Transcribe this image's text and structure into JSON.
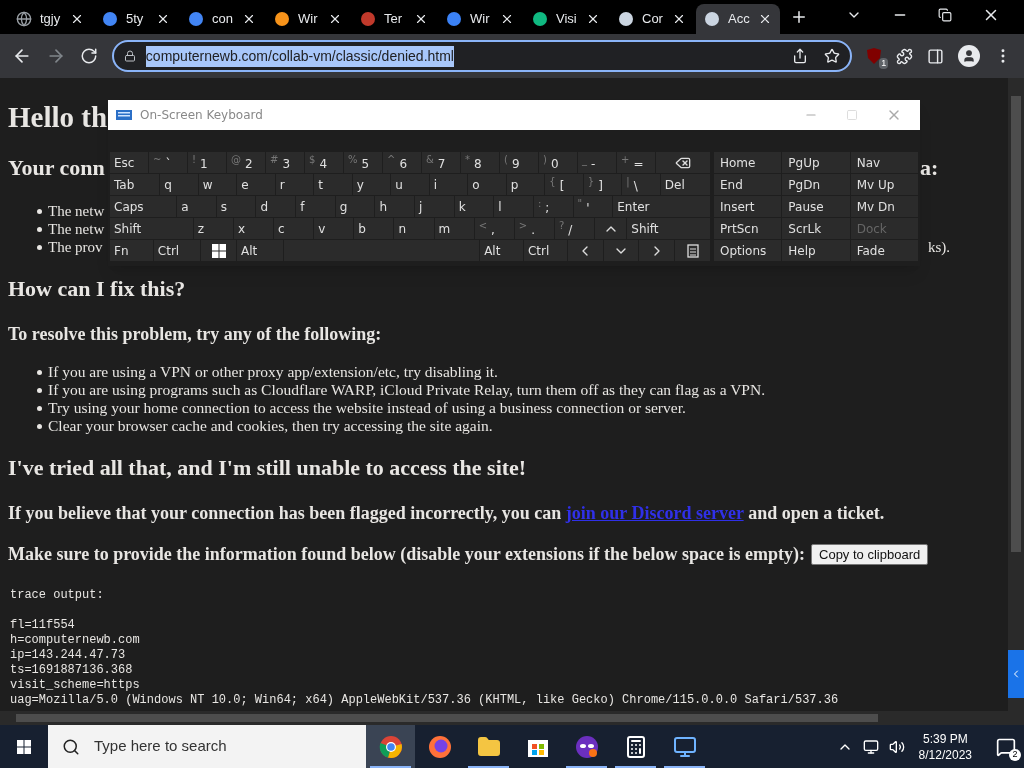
{
  "browser": {
    "tabs": [
      {
        "title": "tgjy",
        "selected": false
      },
      {
        "title": "5ty",
        "selected": false
      },
      {
        "title": "con",
        "selected": false
      },
      {
        "title": "Wir",
        "selected": false
      },
      {
        "title": "Ter",
        "selected": false
      },
      {
        "title": "Wir",
        "selected": false
      },
      {
        "title": "Visi",
        "selected": false
      },
      {
        "title": "Cor",
        "selected": false
      },
      {
        "title": "Acc",
        "selected": true
      }
    ],
    "url": "computernewb.com/collab-vm/classic/denied.html",
    "url_selected": true,
    "extension_badge": "1"
  },
  "page": {
    "heading": "Hello th",
    "section_heading": {
      "left": "Your conn",
      "right": "a:"
    },
    "notice_items": [
      {
        "left": "The netw"
      },
      {
        "left": "The netw"
      },
      {
        "left": "The prov",
        "right": "ks)."
      }
    ],
    "fix_heading": "How can I fix this?",
    "resolve_text": "To resolve this problem, try any of the following:",
    "resolve_items": [
      "If you are using a VPN or other proxy app/extension/etc, try disabling it.",
      "If you are using programs such as Cloudflare WARP, iCloud Private Relay, turn them off as they can flag as a VPN.",
      "Try using your home connection to access the website instead of using a business connection or server.",
      "Clear your browser cache and cookies, then try accessing the site again."
    ],
    "tried_heading": "I've tried all that, and I'm still unable to access the site!",
    "flagged_text": {
      "before": "If you believe that your connection has been flagged incorrectly, you can",
      "link": "join our Discord server",
      "after": "and open a ticket."
    },
    "provide_text": "Make sure to provide the information found below (disable your extensions if the below space is empty):",
    "copy_button": "Copy to clipboard",
    "trace_title": "trace output:",
    "trace_lines": [
      "fl=11f554",
      "h=computernewb.com",
      "ip=143.244.47.73",
      "ts=1691887136.368",
      "visit_scheme=https",
      "uag=Mozilla/5.0 (Windows NT 10.0; Win64; x64) AppleWebKit/537.36 (KHTML, like Gecko) Chrome/115.0.0.0 Safari/537.36"
    ]
  },
  "keyboard": {
    "title": "On-Screen Keyboard",
    "rows": [
      {
        "keys": [
          {
            "kind": "text",
            "label": "Esc"
          },
          {
            "kind": "text",
            "shift": "~",
            "label": "`"
          },
          {
            "kind": "text",
            "shift": "!",
            "label": "1"
          },
          {
            "kind": "text",
            "shift": "@",
            "label": "2"
          },
          {
            "kind": "text",
            "shift": "#",
            "label": "3"
          },
          {
            "kind": "text",
            "shift": "$",
            "label": "4"
          },
          {
            "kind": "text",
            "shift": "%",
            "label": "5"
          },
          {
            "kind": "text",
            "shift": "^",
            "label": "6"
          },
          {
            "kind": "text",
            "shift": "&",
            "label": "7"
          },
          {
            "kind": "text",
            "shift": "*",
            "label": "8"
          },
          {
            "kind": "text",
            "shift": "(",
            "label": "9"
          },
          {
            "kind": "text",
            "shift": ")",
            "label": "0"
          },
          {
            "kind": "text",
            "shift": "_",
            "label": "-"
          },
          {
            "kind": "text",
            "shift": "+",
            "label": "="
          },
          {
            "kind": "backspace"
          }
        ]
      },
      {
        "keys": [
          {
            "kind": "text",
            "label": "Tab"
          },
          {
            "kind": "text",
            "label": "q"
          },
          {
            "kind": "text",
            "label": "w"
          },
          {
            "kind": "text",
            "label": "e"
          },
          {
            "kind": "text",
            "label": "r"
          },
          {
            "kind": "text",
            "label": "t"
          },
          {
            "kind": "text",
            "label": "y"
          },
          {
            "kind": "text",
            "label": "u"
          },
          {
            "kind": "text",
            "label": "i"
          },
          {
            "kind": "text",
            "label": "o"
          },
          {
            "kind": "text",
            "label": "p"
          },
          {
            "kind": "text",
            "shift": "{",
            "label": "["
          },
          {
            "kind": "text",
            "shift": "}",
            "label": "]"
          },
          {
            "kind": "text",
            "shift": "|",
            "label": "\\"
          },
          {
            "kind": "text",
            "label": "Del"
          }
        ]
      },
      {
        "keys": [
          {
            "kind": "text",
            "label": "Caps"
          },
          {
            "kind": "text",
            "label": "a"
          },
          {
            "kind": "text",
            "label": "s"
          },
          {
            "kind": "text",
            "label": "d"
          },
          {
            "kind": "text",
            "label": "f"
          },
          {
            "kind": "text",
            "label": "g"
          },
          {
            "kind": "text",
            "label": "h"
          },
          {
            "kind": "text",
            "label": "j"
          },
          {
            "kind": "text",
            "label": "k"
          },
          {
            "kind": "text",
            "label": "l"
          },
          {
            "kind": "text",
            "shift": ":",
            "label": ";"
          },
          {
            "kind": "text",
            "shift": "\"",
            "label": "'"
          },
          {
            "kind": "text",
            "label": "Enter"
          }
        ]
      },
      {
        "keys": [
          {
            "kind": "text",
            "label": "Shift"
          },
          {
            "kind": "text",
            "label": "z"
          },
          {
            "kind": "text",
            "label": "x"
          },
          {
            "kind": "text",
            "label": "c"
          },
          {
            "kind": "text",
            "label": "v"
          },
          {
            "kind": "text",
            "label": "b"
          },
          {
            "kind": "text",
            "label": "n"
          },
          {
            "kind": "text",
            "label": "m"
          },
          {
            "kind": "text",
            "shift": "<",
            "label": ","
          },
          {
            "kind": "text",
            "shift": ">",
            "label": "."
          },
          {
            "kind": "text",
            "shift": "?",
            "label": "/"
          },
          {
            "kind": "up"
          },
          {
            "kind": "text",
            "label": "Shift"
          }
        ]
      },
      {
        "keys": [
          {
            "kind": "text",
            "label": "Fn"
          },
          {
            "kind": "text",
            "label": "Ctrl"
          },
          {
            "kind": "windows"
          },
          {
            "kind": "text",
            "label": "Alt"
          },
          {
            "kind": "space"
          },
          {
            "kind": "text",
            "label": "Alt"
          },
          {
            "kind": "text",
            "label": "Ctrl"
          },
          {
            "kind": "left"
          },
          {
            "kind": "down"
          },
          {
            "kind": "right"
          },
          {
            "kind": "menu"
          }
        ]
      }
    ],
    "nav_keys": [
      {
        "label": "Home",
        "disabled": false
      },
      {
        "label": "PgUp",
        "disabled": false
      },
      {
        "label": "Nav",
        "disabled": false
      },
      {
        "label": "End",
        "disabled": false
      },
      {
        "label": "PgDn",
        "disabled": false
      },
      {
        "label": "Mv Up",
        "disabled": false
      },
      {
        "label": "Insert",
        "disabled": false
      },
      {
        "label": "Pause",
        "disabled": false
      },
      {
        "label": "Mv Dn",
        "disabled": false
      },
      {
        "label": "PrtScn",
        "disabled": false
      },
      {
        "label": "ScrLk",
        "disabled": false
      },
      {
        "label": "Dock",
        "disabled": true
      },
      {
        "label": "Options",
        "disabled": false
      },
      {
        "label": "Help",
        "disabled": false
      },
      {
        "label": "Fade",
        "disabled": false
      }
    ]
  },
  "taskbar": {
    "search_placeholder": "Type here to search",
    "apps": [
      {
        "kind": "chrome",
        "selected": true,
        "running": true
      },
      {
        "kind": "firefox",
        "selected": false,
        "running": false
      },
      {
        "kind": "folder",
        "selected": false,
        "running": true
      },
      {
        "kind": "store",
        "selected": false,
        "running": false
      },
      {
        "kind": "mask",
        "selected": false,
        "running": true
      },
      {
        "kind": "calculator",
        "selected": false,
        "running": true
      },
      {
        "kind": "remote",
        "selected": false,
        "running": true
      }
    ],
    "time": "5:39 PM",
    "date": "8/12/2023",
    "notification_count": "2"
  }
}
